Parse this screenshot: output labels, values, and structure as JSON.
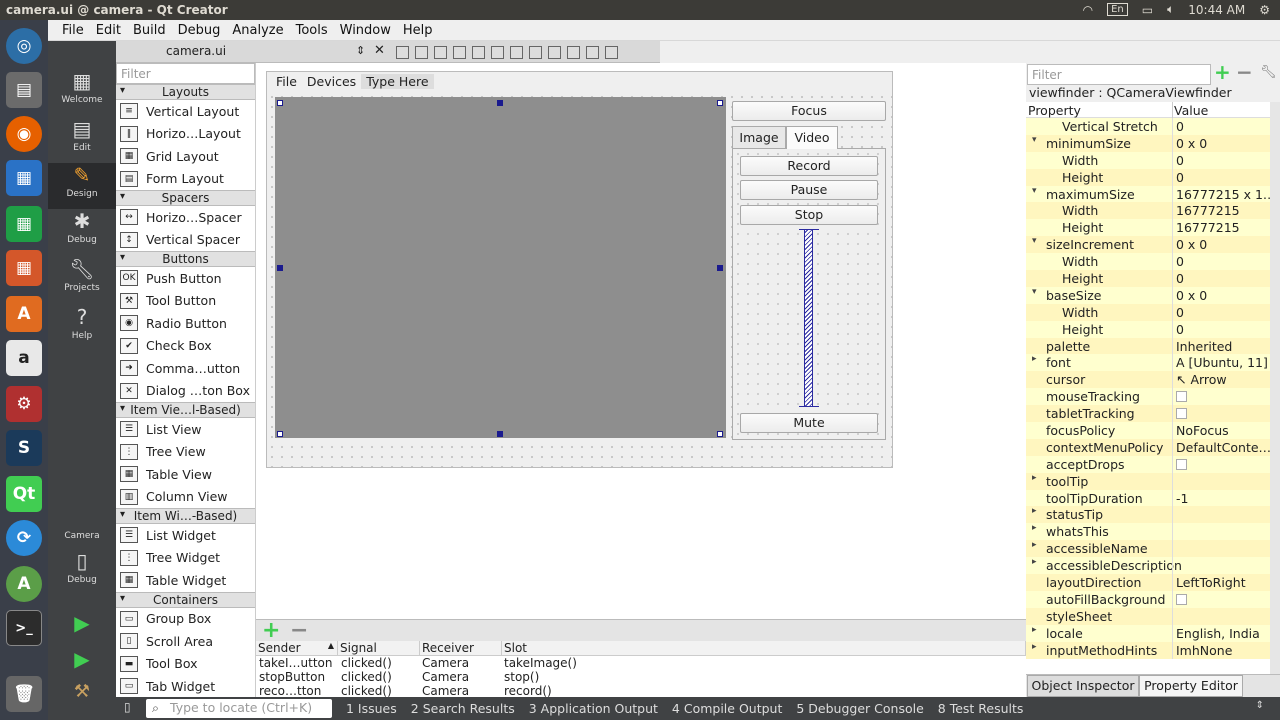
{
  "window_title": "camera.ui @ camera - Qt Creator",
  "tray": {
    "lang": "En",
    "time": "10:44 AM",
    "wifi": "wifi-icon",
    "battery": "battery-icon",
    "volume": "volume-icon",
    "power": "power-icon"
  },
  "menubar": [
    "File",
    "Edit",
    "Build",
    "Debug",
    "Analyze",
    "Tools",
    "Window",
    "Help"
  ],
  "modes": [
    {
      "label": "Welcome",
      "icon": "welcome-icon"
    },
    {
      "label": "Edit",
      "icon": "edit-icon"
    },
    {
      "label": "Design",
      "icon": "design-icon"
    },
    {
      "label": "Debug",
      "icon": "debug-icon"
    },
    {
      "label": "Projects",
      "icon": "projects-icon"
    },
    {
      "label": "Help",
      "icon": "help-icon"
    }
  ],
  "kit": {
    "project": "Camera",
    "mode": "Debug"
  },
  "document_tab": "camera.ui",
  "widget_box": {
    "filter_placeholder": "Filter",
    "categories": [
      {
        "name": "Layouts",
        "items": [
          "Vertical Layout",
          "Horizo…Layout",
          "Grid Layout",
          "Form Layout"
        ]
      },
      {
        "name": "Spacers",
        "items": [
          "Horizo…Spacer",
          "Vertical Spacer"
        ]
      },
      {
        "name": "Buttons",
        "items": [
          "Push Button",
          "Tool Button",
          "Radio Button",
          "Check Box",
          "Comma…utton",
          "Dialog …ton Box"
        ]
      },
      {
        "name": "Item Vie…l-Based)",
        "items": [
          "List View",
          "Tree View",
          "Table View",
          "Column View"
        ]
      },
      {
        "name": "Item Wi…-Based)",
        "items": [
          "List Widget",
          "Tree Widget",
          "Table Widget"
        ]
      },
      {
        "name": "Containers",
        "items": [
          "Group Box",
          "Scroll Area",
          "Tool Box",
          "Tab Widget"
        ]
      }
    ]
  },
  "form": {
    "menu": [
      "File",
      "Devices",
      "Type Here"
    ],
    "focus_button": "Focus",
    "tabs": [
      "Image",
      "Video"
    ],
    "record_button": "Record",
    "pause_button": "Pause",
    "stop_button": "Stop",
    "mute_button": "Mute"
  },
  "signals": {
    "headers": [
      "Sender",
      "Signal",
      "Receiver",
      "Slot"
    ],
    "rows": [
      [
        "takeI…utton",
        "clicked()",
        "Camera",
        "takeImage()"
      ],
      [
        "stopButton",
        "clicked()",
        "Camera",
        "stop()"
      ],
      [
        "reco…tton",
        "clicked()",
        "Camera",
        "record()"
      ]
    ]
  },
  "property_editor": {
    "filter_placeholder": "Filter",
    "object": "viewfinder : QCameraViewfinder",
    "headers": [
      "Property",
      "Value"
    ],
    "rows": [
      {
        "name": "Vertical Stretch",
        "value": "0",
        "sub": true,
        "exp": ""
      },
      {
        "name": "minimumSize",
        "value": "0 x 0",
        "sub": false,
        "exp": "▾"
      },
      {
        "name": "Width",
        "value": "0",
        "sub": true,
        "exp": ""
      },
      {
        "name": "Height",
        "value": "0",
        "sub": true,
        "exp": ""
      },
      {
        "name": "maximumSize",
        "value": "16777215 x 1…",
        "sub": false,
        "exp": "▾"
      },
      {
        "name": "Width",
        "value": "16777215",
        "sub": true,
        "exp": ""
      },
      {
        "name": "Height",
        "value": "16777215",
        "sub": true,
        "exp": ""
      },
      {
        "name": "sizeIncrement",
        "value": "0 x 0",
        "sub": false,
        "exp": "▾"
      },
      {
        "name": "Width",
        "value": "0",
        "sub": true,
        "exp": ""
      },
      {
        "name": "Height",
        "value": "0",
        "sub": true,
        "exp": ""
      },
      {
        "name": "baseSize",
        "value": "0 x 0",
        "sub": false,
        "exp": "▾"
      },
      {
        "name": "Width",
        "value": "0",
        "sub": true,
        "exp": ""
      },
      {
        "name": "Height",
        "value": "0",
        "sub": true,
        "exp": ""
      },
      {
        "name": "palette",
        "value": "Inherited",
        "sub": false,
        "exp": ""
      },
      {
        "name": "font",
        "value": "A  [Ubuntu, 11]",
        "sub": false,
        "exp": "▸"
      },
      {
        "name": "cursor",
        "value": "↖  Arrow",
        "sub": false,
        "exp": ""
      },
      {
        "name": "mouseTracking",
        "value": "",
        "sub": false,
        "exp": "",
        "check": true
      },
      {
        "name": "tabletTracking",
        "value": "",
        "sub": false,
        "exp": "",
        "check": true
      },
      {
        "name": "focusPolicy",
        "value": "NoFocus",
        "sub": false,
        "exp": ""
      },
      {
        "name": "contextMenuPolicy",
        "value": "DefaultConte…",
        "sub": false,
        "exp": ""
      },
      {
        "name": "acceptDrops",
        "value": "",
        "sub": false,
        "exp": "",
        "check": true
      },
      {
        "name": "toolTip",
        "value": "",
        "sub": false,
        "exp": "▸"
      },
      {
        "name": "toolTipDuration",
        "value": "-1",
        "sub": false,
        "exp": ""
      },
      {
        "name": "statusTip",
        "value": "",
        "sub": false,
        "exp": "▸"
      },
      {
        "name": "whatsThis",
        "value": "",
        "sub": false,
        "exp": "▸"
      },
      {
        "name": "accessibleName",
        "value": "",
        "sub": false,
        "exp": "▸"
      },
      {
        "name": "accessibleDescription",
        "value": "",
        "sub": false,
        "exp": "▸"
      },
      {
        "name": "layoutDirection",
        "value": "LeftToRight",
        "sub": false,
        "exp": ""
      },
      {
        "name": "autoFillBackground",
        "value": "",
        "sub": false,
        "exp": "",
        "check": true
      },
      {
        "name": "styleSheet",
        "value": "",
        "sub": false,
        "exp": ""
      },
      {
        "name": "locale",
        "value": "English, India",
        "sub": false,
        "exp": "▸"
      },
      {
        "name": "inputMethodHints",
        "value": "ImhNone",
        "sub": false,
        "exp": "▸"
      }
    ],
    "tabs": [
      "Object Inspector",
      "Property Editor"
    ]
  },
  "statusbar": {
    "locate_placeholder": "Type to locate (Ctrl+K)",
    "panes": [
      "1  Issues",
      "2  Search Results",
      "3  Application Output",
      "4  Compile Output",
      "5  Debugger Console",
      "8  Test Results"
    ]
  },
  "colors": {
    "accent": "#41cd52",
    "launcher": "#3a3f49",
    "modebar": "#404244",
    "property_row": "#ffffcf"
  }
}
